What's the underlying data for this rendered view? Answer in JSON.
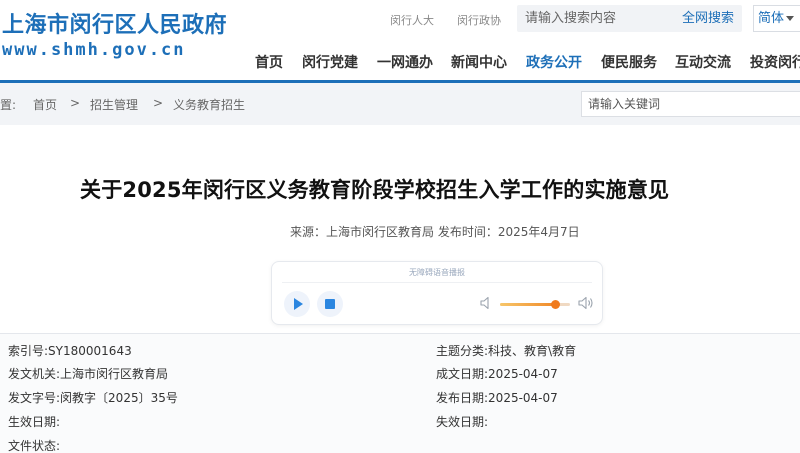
{
  "header": {
    "logo_cn": "上海市闵行区人民政府",
    "logo_en": "www.shmh.gov.cn",
    "top_links": [
      "闵行人大",
      "闵行政协"
    ],
    "search": {
      "placeholder": "请输入搜索内容",
      "button": "全网搜索"
    },
    "language": "简体"
  },
  "nav": {
    "items": [
      {
        "label": "首页"
      },
      {
        "label": "闵行党建"
      },
      {
        "label": "一网通办"
      },
      {
        "label": "新闻中心"
      },
      {
        "label": "政务公开"
      },
      {
        "label": "便民服务"
      },
      {
        "label": "互动交流"
      },
      {
        "label": "投资闵行"
      }
    ],
    "active": "政务公开"
  },
  "breadcrumb": {
    "prefix": "置:",
    "items": [
      "首页",
      "招生管理",
      "义务教育招生"
    ],
    "separator": ">",
    "keyword_placeholder": "请输入关键词"
  },
  "article": {
    "title": "关于2025年闵行区义务教育阶段学校招生入学工作的实施意见",
    "meta": "来源：上海市闵行区教育局  发布时间：2025年4月7日"
  },
  "player": {
    "label": "无障碍语音播报",
    "volume": 0.78
  },
  "info": {
    "left": [
      {
        "label": "索引号:",
        "value": "SY180001643"
      },
      {
        "label": "发文机关:",
        "value": "上海市闵行区教育局"
      },
      {
        "label": "发文字号:",
        "value": "闵教字〔2025〕35号"
      },
      {
        "label": "生效日期:",
        "value": ""
      },
      {
        "label": "文件状态:",
        "value": ""
      }
    ],
    "right": [
      {
        "label": "主题分类:",
        "value": "科技、教育\\教育"
      },
      {
        "label": "成文日期:",
        "value": "2025-04-07"
      },
      {
        "label": "发布日期:",
        "value": "2025-04-07"
      },
      {
        "label": "失效日期:",
        "value": ""
      }
    ]
  }
}
